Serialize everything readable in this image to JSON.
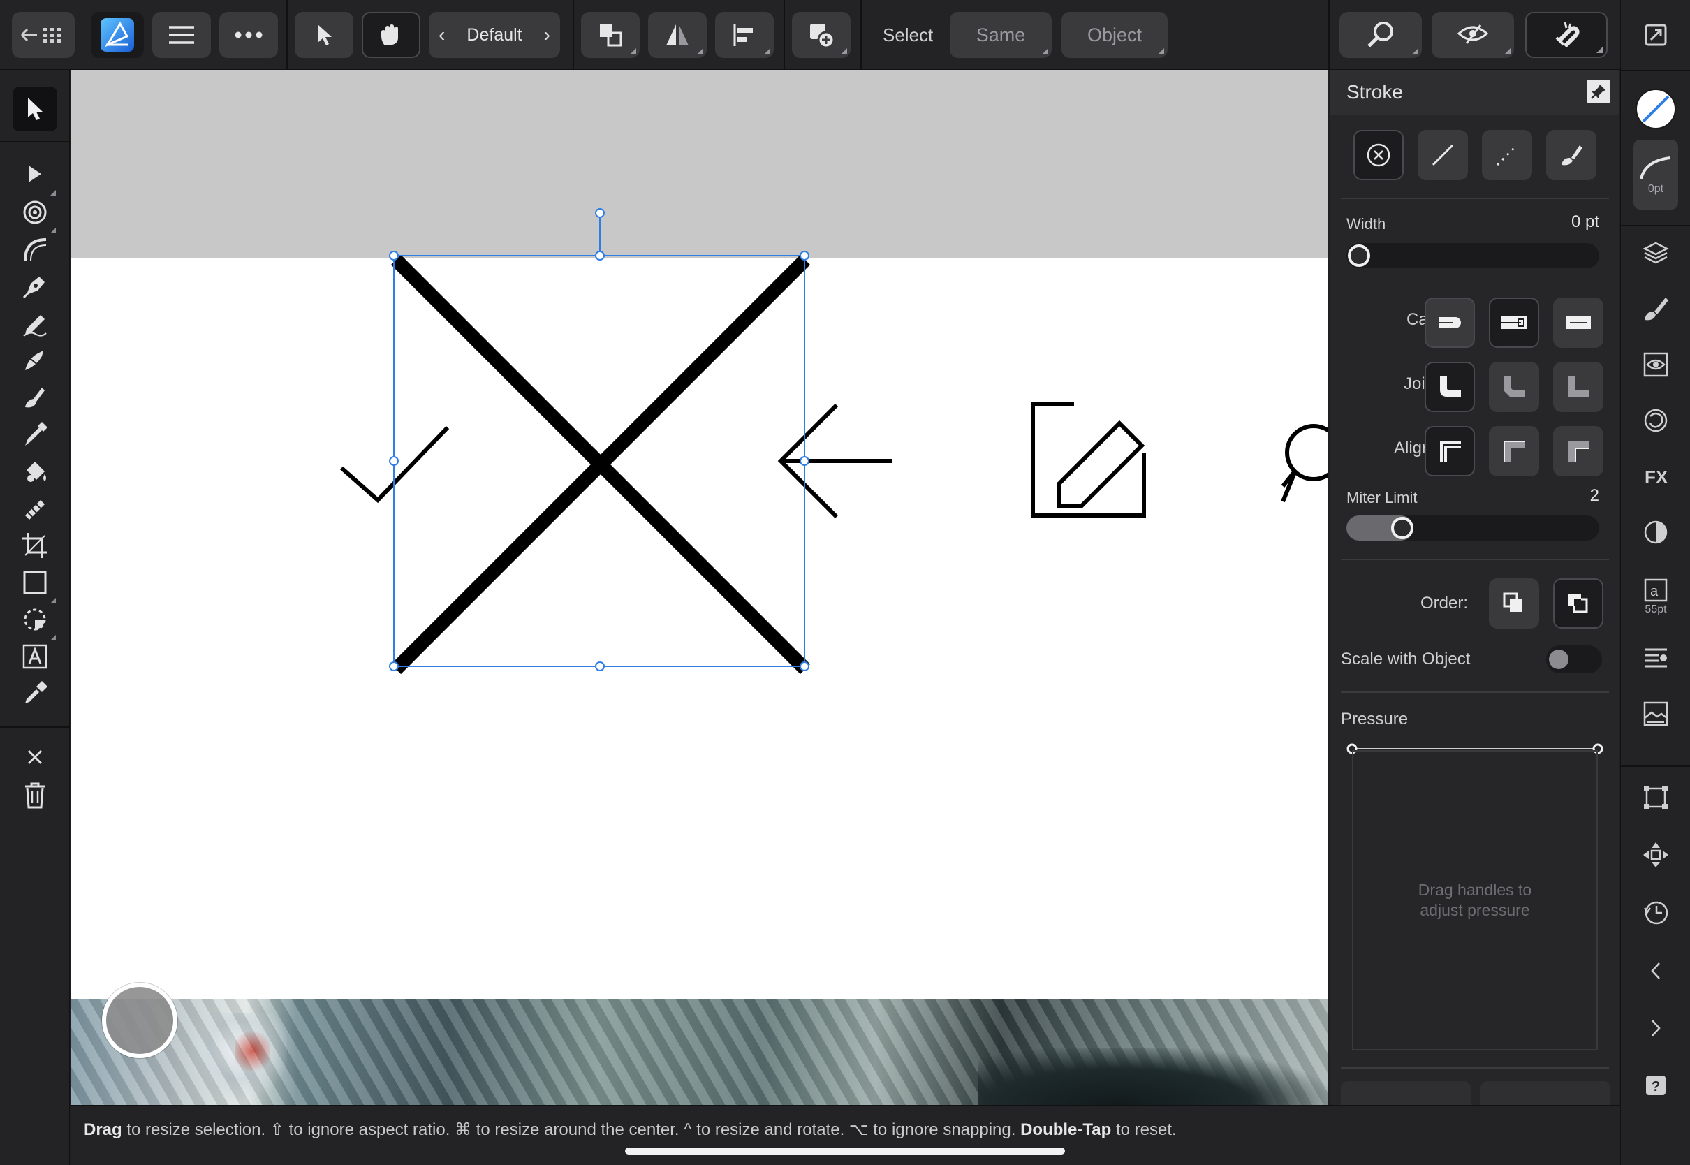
{
  "toolbar": {
    "preset_label": "Default",
    "select_label": "Select",
    "same_label": "Same",
    "object_label": "Object"
  },
  "stroke_panel": {
    "title": "Stroke",
    "width_label": "Width",
    "width_value": "0 pt",
    "width_fraction": 0,
    "cap_label": "Cap:",
    "join_label": "Join:",
    "align_label": "Align:",
    "miter_label": "Miter Limit",
    "miter_value": "2",
    "miter_fraction": 0.19,
    "order_label": "Order:",
    "scale_label": "Scale with Object",
    "scale_on": false,
    "pressure_label": "Pressure",
    "pressure_hint_line1": "Drag handles to",
    "pressure_hint_line2": "adjust pressure"
  },
  "right_rail": {
    "stroke_size": "0pt",
    "text_size": "55pt"
  },
  "status": {
    "k1": "Drag",
    "t1": " to resize selection. ⇧ to ignore aspect ratio. ⌘ to resize around the center. ^ to resize and rotate. ⌥ to ignore snapping. ",
    "k2": "Double-Tap",
    "t2": " to reset."
  },
  "colors": {
    "accent": "#3f86f2",
    "selection": "#2f7ee6",
    "panel": "#262628"
  }
}
